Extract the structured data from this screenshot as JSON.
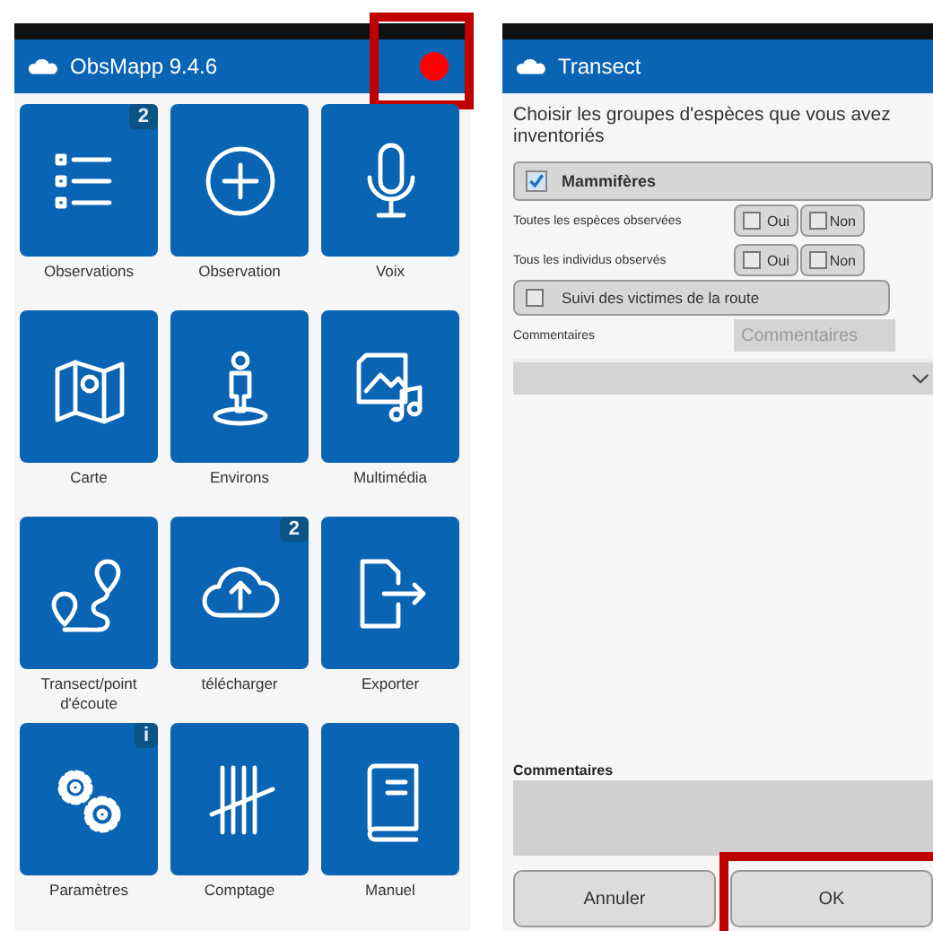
{
  "home": {
    "app_bar": {
      "title": "ObsMapp 9.4.6",
      "recording": true,
      "highlighted": true
    },
    "tiles": [
      {
        "label": "Observations",
        "badge": "2"
      },
      {
        "label": "Observation"
      },
      {
        "label": "Voix"
      },
      {
        "label": "Carte"
      },
      {
        "label": "Environs"
      },
      {
        "label": "Multimédia"
      },
      {
        "label": "Transect/point d'écoute"
      },
      {
        "label": "télécharger",
        "badge": "2"
      },
      {
        "label": "Exporter"
      },
      {
        "label": "Paramètres",
        "badge": "i"
      },
      {
        "label": "Comptage"
      },
      {
        "label": "Manuel"
      }
    ]
  },
  "transect": {
    "title": "Transect",
    "prompt": "Choisir les groupes d'espèces que vous avez inventoriés",
    "group": {
      "label": "Mammifères",
      "checked": true,
      "questions": [
        {
          "label": "Toutes les espèces observées",
          "options": [
            {
              "label": "Oui",
              "checked": false
            },
            {
              "label": "Non",
              "checked": false
            }
          ]
        },
        {
          "label": "Tous les individus observés",
          "options": [
            {
              "label": "Oui",
              "checked": false
            },
            {
              "label": "Non",
              "checked": false
            }
          ]
        }
      ],
      "road_kill": {
        "label": "Suivi des victimes de la route",
        "checked": false
      },
      "comments": {
        "label": "Commentaires",
        "placeholder": "Commentaires"
      }
    },
    "comments_label": "Commentaires",
    "buttons": [
      {
        "label": "Annuler",
        "highlighted": false
      },
      {
        "label": "OK",
        "highlighted": true
      }
    ]
  }
}
